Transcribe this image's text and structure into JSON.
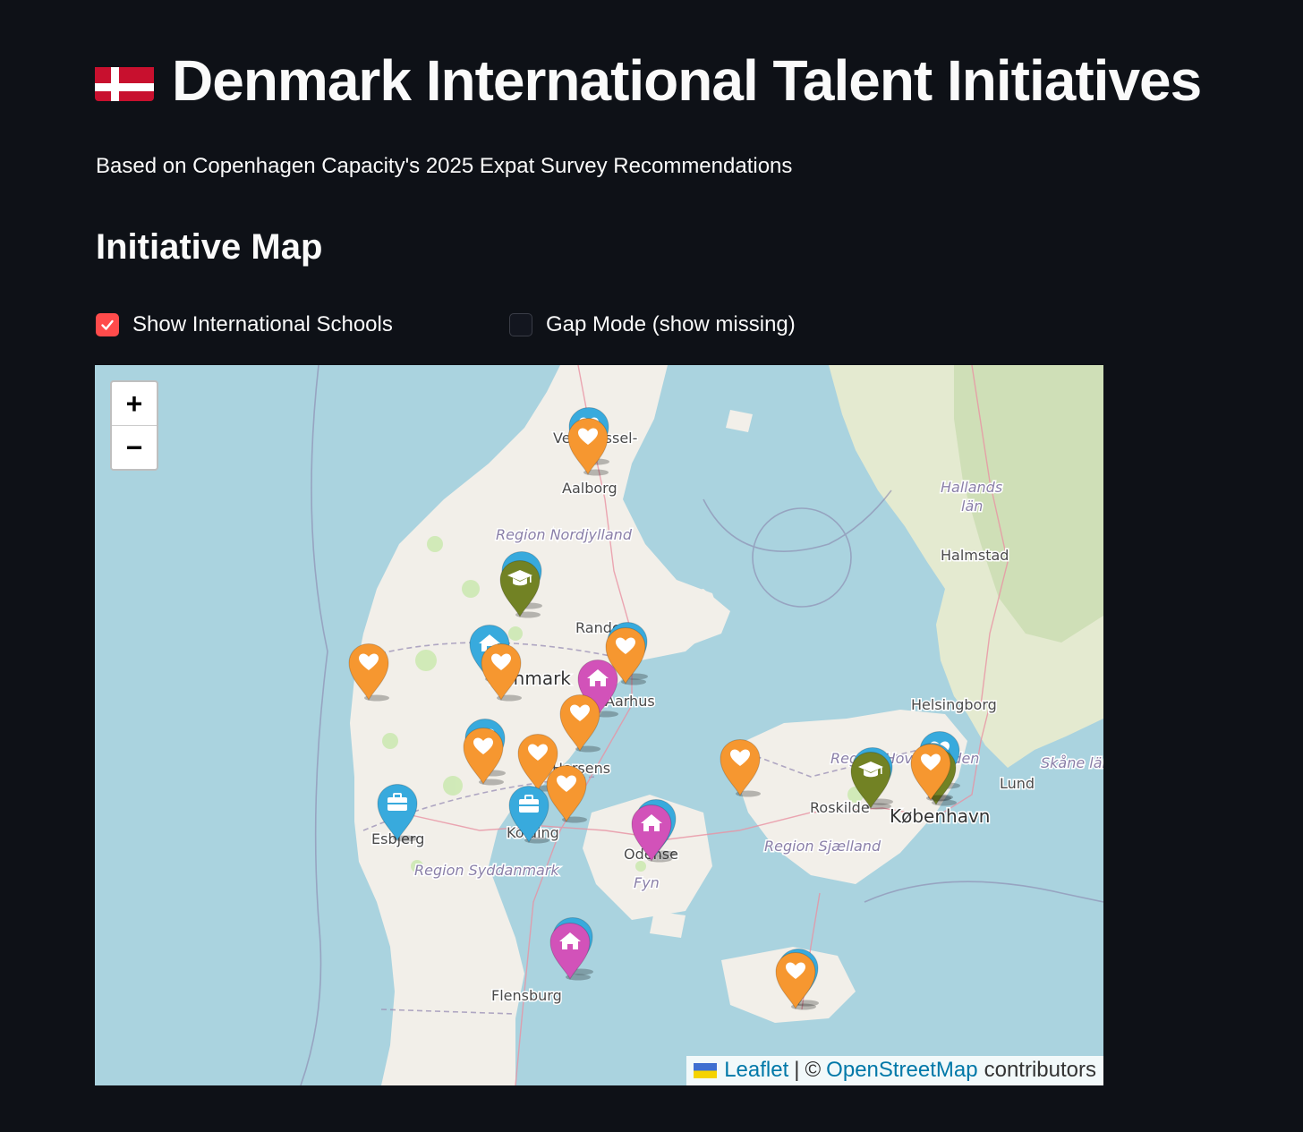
{
  "page": {
    "title": "Denmark International Talent Initiatives",
    "subtitle": "Based on Copenhagen Capacity's 2025 Expat Survey Recommendations",
    "section_heading": "Initiative Map"
  },
  "controls": {
    "schools_toggle": {
      "label": "Show International Schools",
      "checked": true
    },
    "gap_toggle": {
      "label": "Gap Mode (show missing)",
      "checked": false
    }
  },
  "map": {
    "zoom_in": "+",
    "zoom_out": "−",
    "labels": {
      "vendsyssel": "Vendsyssel-",
      "aalborg": "Aalborg",
      "region_nordjylland": "Region Nordjylland",
      "randers": "Randers",
      "denmark": "Danmark",
      "aarhus": "Aarhus",
      "horsens": "Horsens",
      "esbjerg": "Esbjerg",
      "kolding": "Kolding",
      "odense": "Odense",
      "fyn": "Fyn",
      "region_syddanmark": "Region Syddanmark",
      "flensburg": "Flensburg",
      "roskilde": "Roskilde",
      "kobenhavn": "København",
      "region_sjaelland": "Region Sjælland",
      "region_hovedstaden": "Region Hovedstaden",
      "hallands_lan_1": "Hallands",
      "hallands_lan_2": "län",
      "halmstad": "Halmstad",
      "helsingborg": "Helsingborg",
      "lund": "Lund",
      "skane_lan": "Skåne län"
    },
    "marker_colors": {
      "orange": "#f69730",
      "blue": "#38aadd",
      "green": "#728224",
      "magenta": "#d252b9"
    },
    "markers": [
      {
        "type": "blue",
        "icon": "heart-icon",
        "location": "Aalborg"
      },
      {
        "type": "orange",
        "icon": "heart-icon",
        "location": "Aalborg"
      },
      {
        "type": "blue",
        "icon": "graduation-cap-icon",
        "location": "Viborg area"
      },
      {
        "type": "green",
        "icon": "graduation-cap-icon",
        "location": "Viborg area"
      },
      {
        "type": "blue",
        "icon": "home-icon",
        "location": "Herning area"
      },
      {
        "type": "orange",
        "icon": "heart-icon",
        "location": "Herning area"
      },
      {
        "type": "blue",
        "icon": "heart-icon",
        "location": "Randers area"
      },
      {
        "type": "orange",
        "icon": "heart-icon",
        "location": "Randers area"
      },
      {
        "type": "orange",
        "icon": "heart-icon",
        "location": "Ringkøbing"
      },
      {
        "type": "magenta",
        "icon": "home-icon",
        "location": "Aarhus"
      },
      {
        "type": "orange",
        "icon": "heart-icon",
        "location": "Skanderborg"
      },
      {
        "type": "blue",
        "icon": "heart-icon",
        "location": "Billund area"
      },
      {
        "type": "orange",
        "icon": "heart-icon",
        "location": "Billund area"
      },
      {
        "type": "orange",
        "icon": "heart-icon",
        "location": "Vejle"
      },
      {
        "type": "orange",
        "icon": "heart-icon",
        "location": "Fredericia"
      },
      {
        "type": "blue",
        "icon": "briefcase-icon",
        "location": "Esbjerg"
      },
      {
        "type": "blue",
        "icon": "briefcase-icon",
        "location": "Kolding"
      },
      {
        "type": "blue",
        "icon": "home-icon",
        "location": "Odense"
      },
      {
        "type": "magenta",
        "icon": "home-icon",
        "location": "Odense"
      },
      {
        "type": "orange",
        "icon": "heart-icon",
        "location": "Kalundborg"
      },
      {
        "type": "blue",
        "icon": "graduation-cap-icon",
        "location": "Roskilde"
      },
      {
        "type": "green",
        "icon": "graduation-cap-icon",
        "location": "Roskilde"
      },
      {
        "type": "blue",
        "icon": "heart-icon",
        "location": "København"
      },
      {
        "type": "blue",
        "icon": "heart-icon",
        "location": "København"
      },
      {
        "type": "green",
        "icon": "graduation-cap-icon",
        "location": "København"
      },
      {
        "type": "orange",
        "icon": "heart-icon",
        "location": "København"
      },
      {
        "type": "blue",
        "icon": "home-icon",
        "location": "Sønderborg"
      },
      {
        "type": "magenta",
        "icon": "home-icon",
        "location": "Sønderborg"
      },
      {
        "type": "blue",
        "icon": "heart-icon",
        "location": "Lolland"
      },
      {
        "type": "orange",
        "icon": "heart-icon",
        "location": "Lolland"
      }
    ],
    "attribution": {
      "leaflet": "Leaflet",
      "separator": "|",
      "copyright": "©",
      "osm": "OpenStreetMap",
      "contributors": "contributors"
    }
  }
}
